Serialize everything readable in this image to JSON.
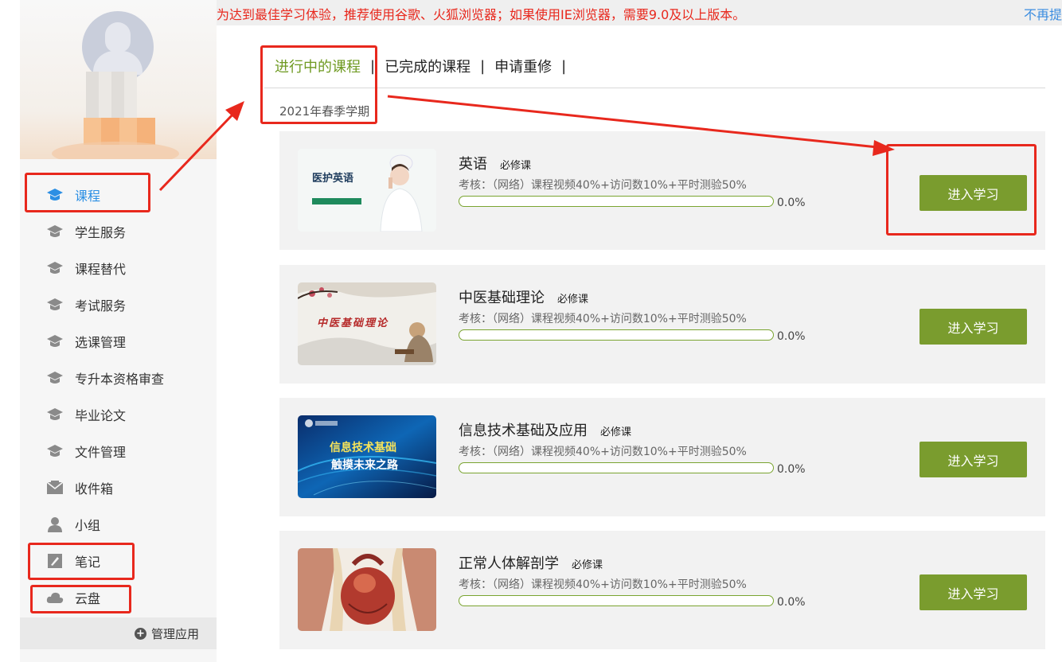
{
  "notice": {
    "text": "为达到最佳学习体验，推荐使用谷歌、火狐浏览器；如果使用IE浏览器，需要9.0及以上版本。",
    "close_label": "不再提"
  },
  "sidebar": {
    "items": [
      {
        "label": "课程",
        "icon": "graduation-cap-icon",
        "active": true
      },
      {
        "label": "学生服务",
        "icon": "graduation-cap-icon"
      },
      {
        "label": "课程替代",
        "icon": "graduation-cap-icon"
      },
      {
        "label": "考试服务",
        "icon": "graduation-cap-icon"
      },
      {
        "label": "选课管理",
        "icon": "graduation-cap-icon"
      },
      {
        "label": "专升本资格审查",
        "icon": "graduation-cap-icon"
      },
      {
        "label": "毕业论文",
        "icon": "graduation-cap-icon"
      },
      {
        "label": "文件管理",
        "icon": "graduation-cap-icon"
      },
      {
        "label": "收件箱",
        "icon": "inbox-icon"
      },
      {
        "label": "小组",
        "icon": "user-icon"
      },
      {
        "label": "笔记",
        "icon": "note-icon"
      },
      {
        "label": "云盘",
        "icon": "cloud-icon"
      }
    ],
    "manage_label": "管理应用"
  },
  "tabs": [
    {
      "label": "进行中的课程",
      "active": true
    },
    {
      "label": "已完成的课程"
    },
    {
      "label": "申请重修"
    }
  ],
  "semester": "2021年春季学期",
  "courses": [
    {
      "title": "英语",
      "tag": "必修课",
      "assessment": "考核：（网络）课程视频40%+访问数10%+平时测验50%",
      "progress": "0.0%",
      "button": "进入学习",
      "thumb_text": "医护英语"
    },
    {
      "title": "中医基础理论",
      "tag": "必修课",
      "assessment": "考核：（网络）课程视频40%+访问数10%+平时测验50%",
      "progress": "0.0%",
      "button": "进入学习",
      "thumb_text": "中医基础理论"
    },
    {
      "title": "信息技术基础及应用",
      "tag": "必修课",
      "assessment": "考核：（网络）课程视频40%+访问数10%+平时测验50%",
      "progress": "0.0%",
      "button": "进入学习",
      "thumb_text": "信息技术基础",
      "thumb_text2": "触摸未来之路"
    },
    {
      "title": "正常人体解剖学",
      "tag": "必修课",
      "assessment": "考核：（网络）课程视频40%+访问数10%+平时测验50%",
      "progress": "0.0%",
      "button": "进入学习"
    }
  ],
  "colors": {
    "accent_green": "#7a9c2e",
    "active_blue": "#2b8fe4",
    "annotation_red": "#e8281d",
    "notice_red": "#e8281d"
  }
}
